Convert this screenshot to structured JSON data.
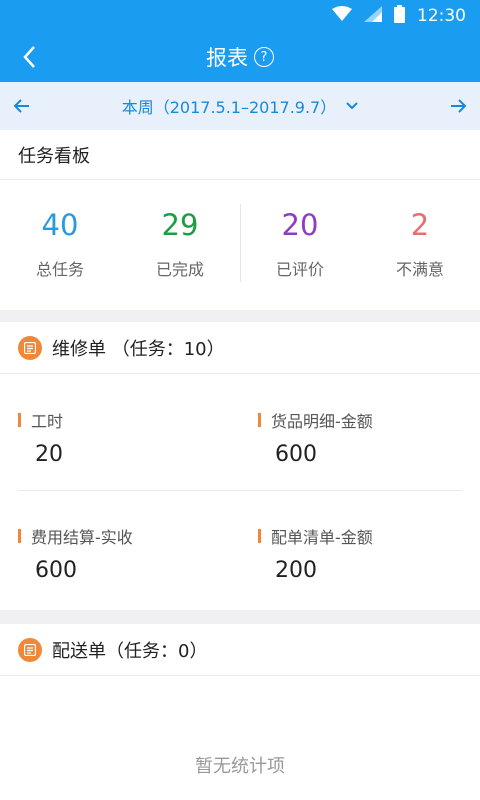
{
  "status_bar": {
    "time": "12:30"
  },
  "app_bar": {
    "title": "报表",
    "help_icon": "?"
  },
  "date_bar": {
    "range": "本周（2017.5.1–2017.9.7）"
  },
  "task_board": {
    "title": "任务看板",
    "stats": [
      {
        "value": "40",
        "label": "总任务",
        "color": "#2a9ae0"
      },
      {
        "value": "29",
        "label": "已完成",
        "color": "#1e9c44"
      },
      {
        "value": "20",
        "label": "已评价",
        "color": "#8e3cc8"
      },
      {
        "value": "2",
        "label": "不满意",
        "color": "#e96d6d"
      }
    ]
  },
  "repair": {
    "title": "维修单 （任务：10）",
    "metrics": [
      {
        "label": "工时",
        "value": "20"
      },
      {
        "label": "货品明细-金额",
        "value": "600"
      },
      {
        "label": "费用结算-实收",
        "value": "600"
      },
      {
        "label": "配单清单-金额",
        "value": "200"
      }
    ]
  },
  "delivery": {
    "title": "配送单（任务：0）",
    "empty_text": "暂无统计项"
  },
  "colors": {
    "primary": "#1a9cf0",
    "accent": "#f0883a"
  }
}
